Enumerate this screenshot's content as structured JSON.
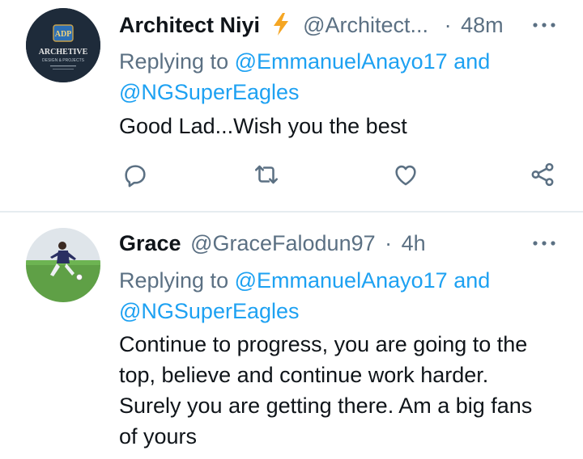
{
  "tweets": [
    {
      "name": "Architect Niyi",
      "handle": "@Architect...",
      "separator": "·",
      "time": "48m",
      "replying_prefix": "Replying to",
      "mention1": "@EmmanuelAnayo17",
      "and_word": "and",
      "mention2": "@NGSuperEagles",
      "text": "Good Lad...Wish you the best",
      "avatar_logo": "ADP",
      "avatar_brand": "ARCHETIVE",
      "avatar_sub": "DESIGN & PROJECTS",
      "more_icon": "more-horizontal-icon"
    },
    {
      "name": "Grace",
      "handle": "@GraceFalodun97",
      "separator": "·",
      "time": "4h",
      "replying_prefix": "Replying to",
      "mention1": "@EmmanuelAnayo17",
      "and_word": "and",
      "mention2": "@NGSuperEagles",
      "text_lines": [
        "Continue to progress, you are going to the",
        "top, believe and continue work harder.",
        "Surely you are getting there. Am a big fans",
        "of yours"
      ],
      "more_icon": "more-horizontal-icon"
    }
  ],
  "actions": [
    "reply-icon",
    "retweet-icon",
    "like-icon",
    "share-icon"
  ],
  "colors": {
    "accent": "#1da1f2",
    "secondary_text": "#5b7083",
    "primary_text": "#0f1419",
    "verified_bolt": "#f5a623",
    "divider": "#e6ecf0"
  }
}
